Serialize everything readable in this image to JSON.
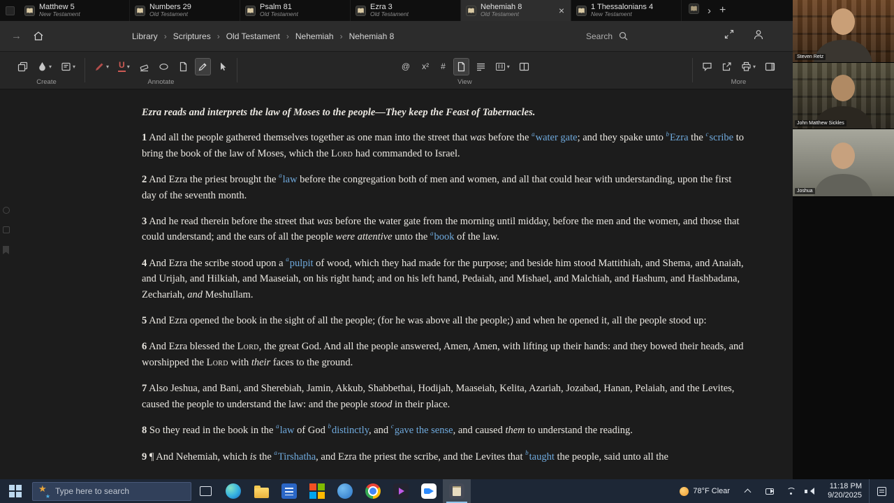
{
  "colors": {
    "link": "#6fa9dc",
    "text": "#eae7e1",
    "selection": "#3e3e3e",
    "taskbar": "#1d2736"
  },
  "icons": {
    "close": "×",
    "tab_next": "›",
    "tab_add": "+",
    "chevron_down": "▾",
    "crumb_sep": "›",
    "forward_arrow": "→",
    "star": "★",
    "at_glyph": "@",
    "superscript_glyph": "x²",
    "hash_glyph": "#",
    "underline_glyph": "U"
  },
  "tabs": [
    {
      "title": "Matthew 5",
      "subtitle": "New Testament",
      "active": false
    },
    {
      "title": "Numbers 29",
      "subtitle": "Old Testament",
      "active": false
    },
    {
      "title": "Psalm 81",
      "subtitle": "Old Testament",
      "active": false
    },
    {
      "title": "Ezra 3",
      "subtitle": "Old Testament",
      "active": false
    },
    {
      "title": "Nehemiah 8",
      "subtitle": "Old Testament",
      "active": true
    },
    {
      "title": "1 Thessalonians 4",
      "subtitle": "New Testament",
      "active": false
    }
  ],
  "nav": {
    "breadcrumb": [
      "Library",
      "Scriptures",
      "Old Testament",
      "Nehemiah",
      "Nehemiah 8"
    ],
    "search_label": "Search"
  },
  "ribbon": {
    "groups": [
      {
        "label": "Create"
      },
      {
        "label": "Annotate"
      },
      {
        "label": "View"
      },
      {
        "label": "More"
      }
    ]
  },
  "reader": {
    "heading": "Ezra reads and interprets the law of Moses to the people—They keep the Feast of Tabernacles.",
    "verses": [
      {
        "num": "1",
        "segments": [
          {
            "t": "And all the people gathered themselves together as one man into the street that ",
            "s": "n"
          },
          {
            "t": "was",
            "s": "i"
          },
          {
            "t": " before the ",
            "s": "n"
          },
          {
            "t": "a",
            "s": "f"
          },
          {
            "t": "water gate",
            "s": "l"
          },
          {
            "t": "; and they spake unto ",
            "s": "n"
          },
          {
            "t": "b",
            "s": "f"
          },
          {
            "t": "Ezra",
            "s": "l"
          },
          {
            "t": " the ",
            "s": "n"
          },
          {
            "t": "c",
            "s": "f"
          },
          {
            "t": "scribe",
            "s": "l"
          },
          {
            "t": " to bring the book of the law of Moses, which the ",
            "s": "n"
          },
          {
            "t": "Lord",
            "s": "sc"
          },
          {
            "t": " had commanded to Israel.",
            "s": "n"
          }
        ]
      },
      {
        "num": "2",
        "segments": [
          {
            "t": "And Ezra the priest brought the ",
            "s": "n"
          },
          {
            "t": "a",
            "s": "f"
          },
          {
            "t": "law",
            "s": "l"
          },
          {
            "t": " before the congregation both of men and women, and all that could hear with understanding, upon the first day of the seventh month.",
            "s": "n"
          }
        ]
      },
      {
        "num": "3",
        "segments": [
          {
            "t": "And he read therein before the street that ",
            "s": "n"
          },
          {
            "t": "was",
            "s": "i"
          },
          {
            "t": " before the water gate from the morning until midday, before the men and the women, and those that could understand; and the ears of all the people ",
            "s": "n"
          },
          {
            "t": "were attentive",
            "s": "i"
          },
          {
            "t": " unto the ",
            "s": "n"
          },
          {
            "t": "a",
            "s": "f"
          },
          {
            "t": "book",
            "s": "l"
          },
          {
            "t": " of the law.",
            "s": "n"
          }
        ]
      },
      {
        "num": "4",
        "segments": [
          {
            "t": "And Ezra the scribe stood upon a ",
            "s": "n"
          },
          {
            "t": "a",
            "s": "f"
          },
          {
            "t": "pulpit",
            "s": "l"
          },
          {
            "t": " of wood, which they had made for the purpose; and beside him stood Mattithiah, and Shema, and Anaiah, and Urijah, and Hilkiah, and Maaseiah, on his right hand; and on his left hand, Pedaiah, and Mishael, and Malchiah, and Hashum, and Hashbadana, Zechariah, ",
            "s": "n"
          },
          {
            "t": "and",
            "s": "i"
          },
          {
            "t": " Meshullam.",
            "s": "n"
          }
        ]
      },
      {
        "num": "5",
        "segments": [
          {
            "t": "And Ezra opened the book in the sight of all the people; (for he was above all the people;) and when he opened it, all the people stood up:",
            "s": "n"
          }
        ]
      },
      {
        "num": "6",
        "segments": [
          {
            "t": "And Ezra blessed the ",
            "s": "n"
          },
          {
            "t": "Lord",
            "s": "sc"
          },
          {
            "t": ", the great God. And all the people answered, Amen, Amen, with lifting up their hands: and they bowed their heads, and worshipped the ",
            "s": "n"
          },
          {
            "t": "Lord",
            "s": "sc"
          },
          {
            "t": " with ",
            "s": "n"
          },
          {
            "t": "their",
            "s": "i"
          },
          {
            "t": " faces to the ground.",
            "s": "n"
          }
        ]
      },
      {
        "num": "7",
        "segments": [
          {
            "t": "Also Jeshua, and Bani, and Sherebiah, Jamin, Akkub, Shabbethai, Hodijah, Maaseiah, Kelita, Azariah, Jozabad, Hanan, Pelaiah, and the Levites, caused the people to understand the law: and the people ",
            "s": "n"
          },
          {
            "t": "stood",
            "s": "i"
          },
          {
            "t": " in their place.",
            "s": "n"
          }
        ]
      },
      {
        "num": "8",
        "segments": [
          {
            "t": "So they read in the book in the ",
            "s": "n"
          },
          {
            "t": "a",
            "s": "f"
          },
          {
            "t": "law",
            "s": "l"
          },
          {
            "t": " of God ",
            "s": "n"
          },
          {
            "t": "b",
            "s": "f"
          },
          {
            "t": "distinctly",
            "s": "l"
          },
          {
            "t": ", and ",
            "s": "n"
          },
          {
            "t": "c",
            "s": "f"
          },
          {
            "t": "gave the sense",
            "s": "l"
          },
          {
            "t": ", and caused ",
            "s": "n"
          },
          {
            "t": "them",
            "s": "i"
          },
          {
            "t": " to understand the reading.",
            "s": "n"
          }
        ]
      },
      {
        "num": "9",
        "segments": [
          {
            "t": "¶ And Nehemiah, which ",
            "s": "n"
          },
          {
            "t": "is",
            "s": "i"
          },
          {
            "t": " the ",
            "s": "n"
          },
          {
            "t": "a",
            "s": "f"
          },
          {
            "t": "Tirshatha",
            "s": "l"
          },
          {
            "t": ", and Ezra the priest the scribe, and the Levites that ",
            "s": "n"
          },
          {
            "t": "b",
            "s": "f"
          },
          {
            "t": "taught",
            "s": "l"
          },
          {
            "t": " the people, said unto all the",
            "s": "n"
          }
        ]
      }
    ]
  },
  "meeting": {
    "participants": [
      {
        "name": "Steven Retz",
        "theme": "warm"
      },
      {
        "name": "John Matthew Sickles",
        "theme": "dim"
      },
      {
        "name": "Joshua",
        "theme": "light"
      }
    ]
  },
  "taskbar": {
    "search_placeholder": "Type here to search",
    "apps": [
      {
        "id": "task-view"
      },
      {
        "id": "edge"
      },
      {
        "id": "file-explorer"
      },
      {
        "id": "word"
      },
      {
        "id": "ms-apps"
      },
      {
        "id": "teams"
      },
      {
        "id": "chrome"
      },
      {
        "id": "media-player"
      },
      {
        "id": "zoom"
      },
      {
        "id": "logos",
        "active": true
      }
    ],
    "weather": "78°F Clear",
    "time": "11:18 PM",
    "date": "9/20/2025"
  }
}
